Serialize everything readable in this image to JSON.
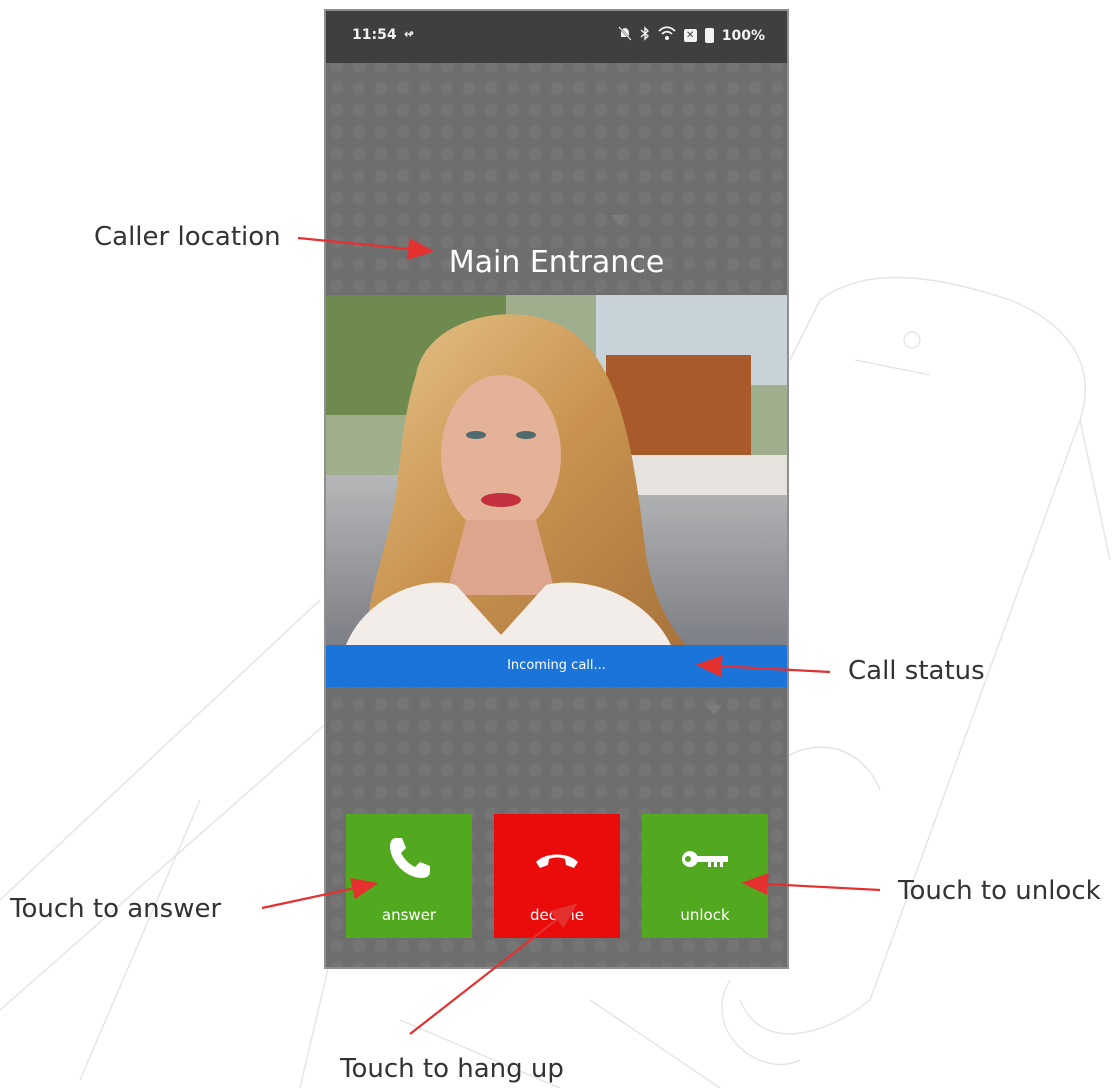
{
  "phone": {
    "status": {
      "time": "11:54",
      "call_glyph": "↫",
      "battery": "100%",
      "icons": [
        "bell-off-icon",
        "bluetooth-icon",
        "wifi-icon",
        "sim-icon",
        "battery-icon"
      ]
    },
    "caller_location": "Main Entrance",
    "call_status": "Incoming call...",
    "buttons": {
      "answer": "answer",
      "decline": "decline",
      "unlock": "unlock"
    }
  },
  "annotations": {
    "caller_location": "Caller location",
    "call_status": "Call status",
    "answer": "Touch to answer",
    "unlock": "Touch to unlock",
    "hang_up": "Touch to hang up"
  },
  "colors": {
    "answer": "#52a81e",
    "decline": "#ea0b0b",
    "status_strip": "#1b74d9",
    "arrow": "#e53030",
    "screen": "#6e6e6e"
  }
}
